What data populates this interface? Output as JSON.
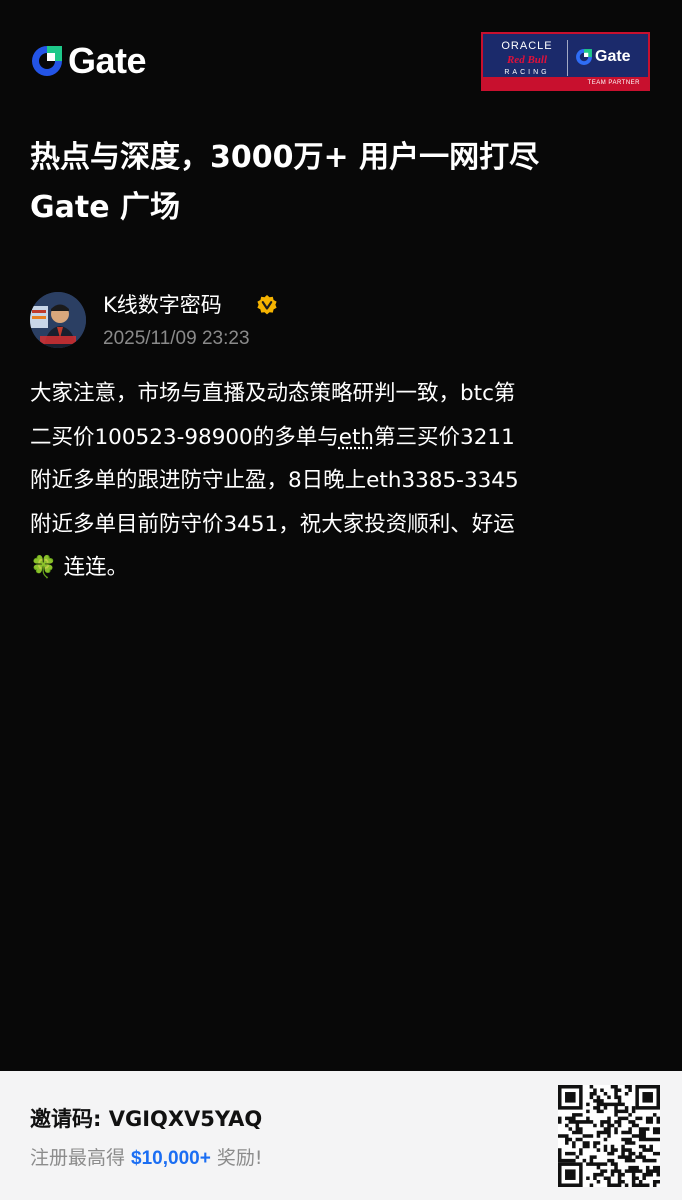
{
  "header": {
    "brand_name": "Gate",
    "brand_color": "#2354e6",
    "partner": {
      "line1": "ORACLE",
      "line2": "Red Bull",
      "line3": "RACING",
      "gate_label": "Gate",
      "footer": "TEAM PARTNER"
    }
  },
  "headline": {
    "line1": "热点与深度，3000万+ 用户一网打尽",
    "line2": "Gate 广场"
  },
  "author": {
    "name": "K线数字密码",
    "time": "2025/11/09 23:23",
    "verified_icon": "verified-badge-icon",
    "verified_color": "#f5b300"
  },
  "post": {
    "line1": "大家注意，市场与直播及动态策略研判一致，btc第",
    "line2_pre": "二买价100523-98900的多单与",
    "line2_link": "eth",
    "line2_post": "第三买价3211",
    "line3": "附近多单的跟进防守止盈，8日晚上eth3385-3345",
    "line4": "附近多单目前防守价3451，祝大家投资顺利、好运",
    "line5_emoji": "🍀",
    "line5_text": " 连连。"
  },
  "footer": {
    "invite_label": "邀请码: VGIQXV5YAQ",
    "reward_pre": "注册最高得 ",
    "reward_amount": "$10,000+",
    "reward_post": " 奖励!",
    "accent_color": "#1b6ef3"
  }
}
